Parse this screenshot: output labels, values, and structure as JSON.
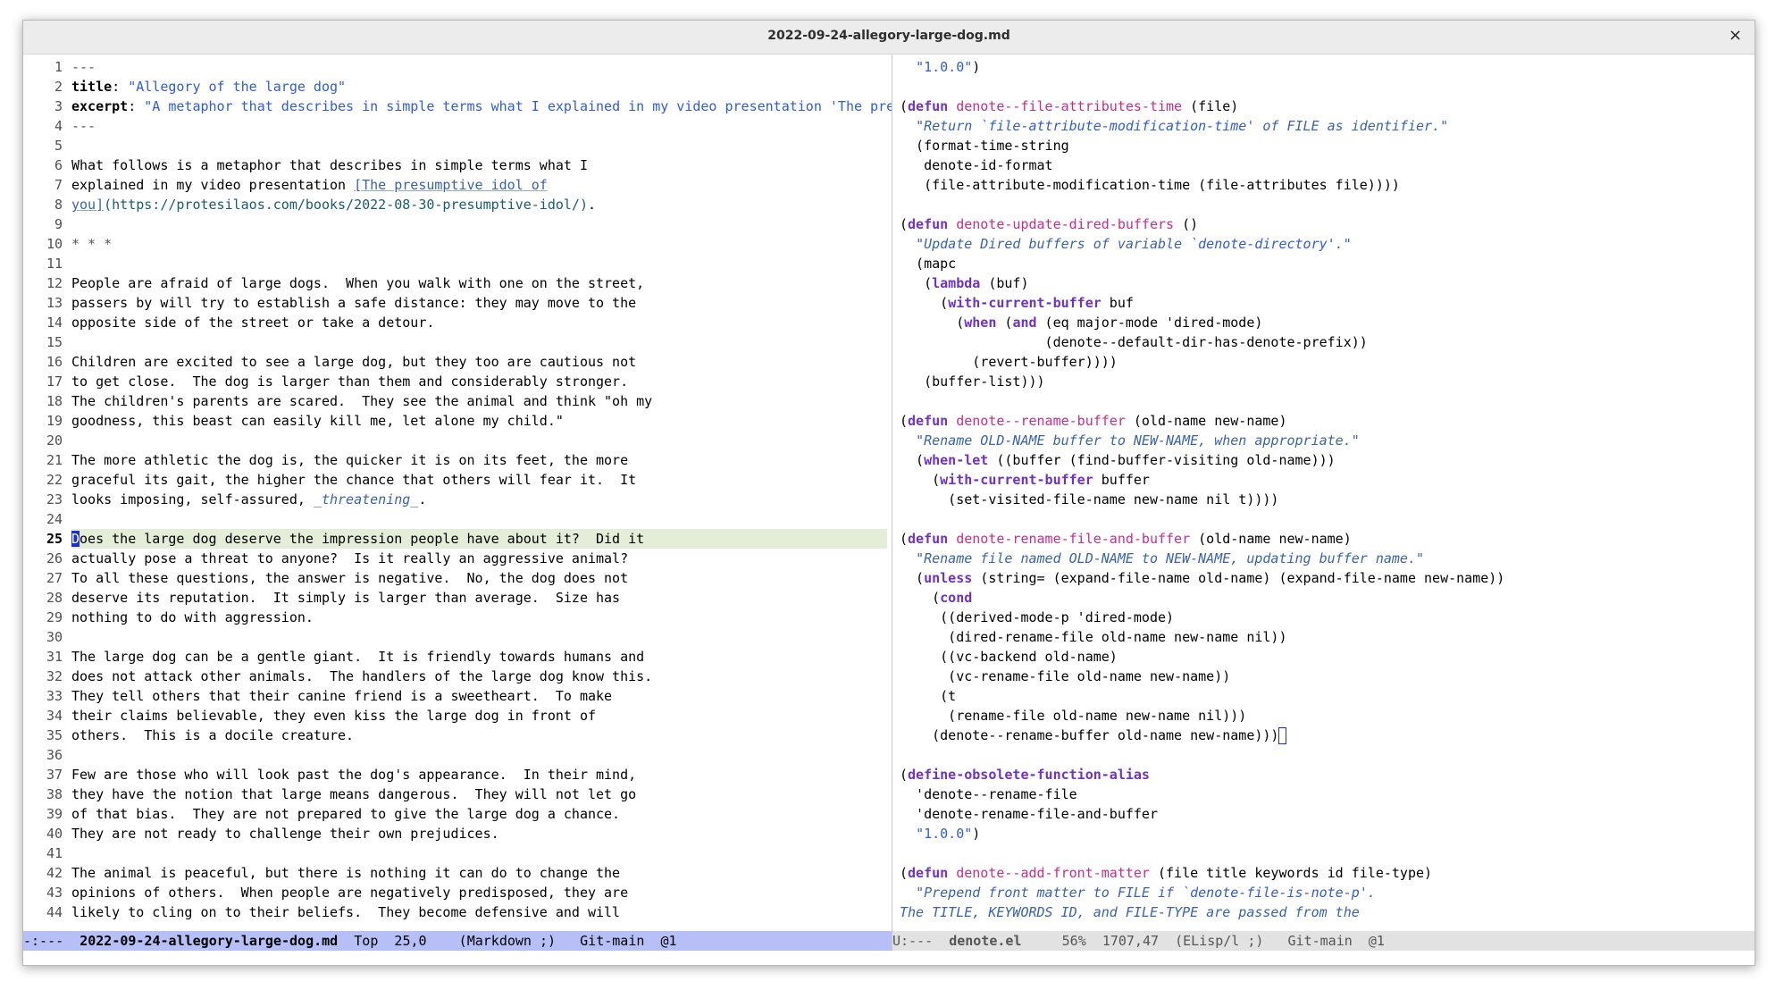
{
  "window": {
    "title": "2022-09-24-allegory-large-dog.md",
    "close_glyph": "×"
  },
  "left_pane": {
    "lines": [
      {
        "n": "1",
        "segs": [
          {
            "t": "---",
            "c": "mark"
          }
        ]
      },
      {
        "n": "2",
        "segs": [
          {
            "t": "title",
            "c": "hdr"
          },
          {
            "t": ": "
          },
          {
            "t": "\"Allegory of the large dog\"",
            "c": "str"
          }
        ]
      },
      {
        "n": "3",
        "segs": [
          {
            "t": "excerpt",
            "c": "hdr"
          },
          {
            "t": ": "
          },
          {
            "t": "\"A metaphor that describes in simple terms what I explained in my video presentation 'The presumpti",
            "c": "str"
          },
          {
            "t": "↩",
            "c": "mark"
          }
        ]
      },
      {
        "n": "4",
        "segs": [
          {
            "t": "---",
            "c": "mark"
          }
        ]
      },
      {
        "n": "5",
        "segs": []
      },
      {
        "n": "6",
        "segs": [
          {
            "t": "What follows is a metaphor that describes in simple terms what I"
          }
        ]
      },
      {
        "n": "7",
        "segs": [
          {
            "t": "explained in my video presentation "
          },
          {
            "t": "[The presumptive idol of",
            "c": "link"
          }
        ]
      },
      {
        "n": "8",
        "segs": [
          {
            "t": "you]",
            "c": "link"
          },
          {
            "t": "(https://protesilaos.com/books/2022-08-30-presumptive-idol/)",
            "c": "url"
          },
          {
            "t": "."
          }
        ]
      },
      {
        "n": "9",
        "segs": []
      },
      {
        "n": "10",
        "segs": [
          {
            "t": "* * *",
            "c": "mark"
          }
        ]
      },
      {
        "n": "11",
        "segs": []
      },
      {
        "n": "12",
        "segs": [
          {
            "t": "People are afraid of large dogs.  When you walk with one on the street,"
          }
        ]
      },
      {
        "n": "13",
        "segs": [
          {
            "t": "passers by will try to establish a safe distance: they may move to the"
          }
        ]
      },
      {
        "n": "14",
        "segs": [
          {
            "t": "opposite side of the street or take a detour."
          }
        ]
      },
      {
        "n": "15",
        "segs": []
      },
      {
        "n": "16",
        "segs": [
          {
            "t": "Children are excited to see a large dog, but they too are cautious not"
          }
        ]
      },
      {
        "n": "17",
        "segs": [
          {
            "t": "to get close.  The dog is larger than them and considerably stronger."
          }
        ]
      },
      {
        "n": "18",
        "segs": [
          {
            "t": "The children's parents are scared.  They see the animal and think \"oh my"
          }
        ]
      },
      {
        "n": "19",
        "segs": [
          {
            "t": "goodness, this beast can easily kill me, let alone my child.\""
          }
        ]
      },
      {
        "n": "20",
        "segs": []
      },
      {
        "n": "21",
        "segs": [
          {
            "t": "The more athletic the dog is, the quicker it is on its feet, the more"
          }
        ]
      },
      {
        "n": "22",
        "segs": [
          {
            "t": "graceful its gait, the higher the chance that others will fear it.  It"
          }
        ]
      },
      {
        "n": "23",
        "segs": [
          {
            "t": "looks imposing, self-assured, "
          },
          {
            "t": "_threatening_",
            "c": "doc"
          },
          {
            "t": "."
          }
        ]
      },
      {
        "n": "24",
        "segs": []
      },
      {
        "n": "25",
        "cur": true,
        "segs": [
          {
            "t": "D",
            "c": "cursor"
          },
          {
            "t": "oes the large dog deserve the impression people have about it?  Did it"
          }
        ]
      },
      {
        "n": "26",
        "segs": [
          {
            "t": "actually pose a threat to anyone?  Is it really an aggressive animal?"
          }
        ]
      },
      {
        "n": "27",
        "segs": [
          {
            "t": "To all these questions, the answer is negative.  No, the dog does not"
          }
        ]
      },
      {
        "n": "28",
        "segs": [
          {
            "t": "deserve its reputation.  It simply is larger than average.  Size has"
          }
        ]
      },
      {
        "n": "29",
        "segs": [
          {
            "t": "nothing to do with aggression."
          }
        ]
      },
      {
        "n": "30",
        "segs": []
      },
      {
        "n": "31",
        "segs": [
          {
            "t": "The large dog can be a gentle giant.  It is friendly towards humans and"
          }
        ]
      },
      {
        "n": "32",
        "segs": [
          {
            "t": "does not attack other animals.  The handlers of the large dog know this."
          }
        ]
      },
      {
        "n": "33",
        "segs": [
          {
            "t": "They tell others that their canine friend is a sweetheart.  To make"
          }
        ]
      },
      {
        "n": "34",
        "segs": [
          {
            "t": "their claims believable, they even kiss the large dog in front of"
          }
        ]
      },
      {
        "n": "35",
        "segs": [
          {
            "t": "others.  This is a docile creature."
          }
        ]
      },
      {
        "n": "36",
        "segs": []
      },
      {
        "n": "37",
        "segs": [
          {
            "t": "Few are those who will look past the dog's appearance.  In their mind,"
          }
        ]
      },
      {
        "n": "38",
        "segs": [
          {
            "t": "they have the notion that large means dangerous.  They will not let go"
          }
        ]
      },
      {
        "n": "39",
        "segs": [
          {
            "t": "of that bias.  They are not prepared to give the large dog a chance."
          }
        ]
      },
      {
        "n": "40",
        "segs": [
          {
            "t": "They are not ready to challenge their own prejudices."
          }
        ]
      },
      {
        "n": "41",
        "segs": []
      },
      {
        "n": "42",
        "segs": [
          {
            "t": "The animal is peaceful, but there is nothing it can do to change the"
          }
        ]
      },
      {
        "n": "43",
        "segs": [
          {
            "t": "opinions of others.  When people are negatively predisposed, they are"
          }
        ]
      },
      {
        "n": "44",
        "segs": [
          {
            "t": "likely to cling on to their beliefs.  They become defensive and will"
          }
        ]
      }
    ],
    "modeline": {
      "state": "-:---",
      "buffer": "2022-09-24-allegory-large-dog.md",
      "position": "Top",
      "linecol": "25,0",
      "mode": "(Markdown ;)",
      "vc": "Git-main",
      "tab": "@1"
    }
  },
  "right_pane": {
    "lines": [
      [
        {
          "t": "  "
        },
        {
          "t": "\"1.0.0\"",
          "c": "str"
        },
        {
          "t": ")"
        }
      ],
      [],
      [
        {
          "t": "("
        },
        {
          "t": "defun",
          "c": "kw"
        },
        {
          "t": " "
        },
        {
          "t": "denote--file-attributes-time",
          "c": "fn"
        },
        {
          "t": " (file)"
        }
      ],
      [
        {
          "t": "  "
        },
        {
          "t": "\"Return `",
          "c": "doc"
        },
        {
          "t": "file-attribute-modification-time",
          "c": "docsym"
        },
        {
          "t": "' of FILE as identifier.\"",
          "c": "doc"
        }
      ],
      [
        {
          "t": "  (format-time-string"
        }
      ],
      [
        {
          "t": "   denote-id-format"
        }
      ],
      [
        {
          "t": "   (file-attribute-modification-time (file-attributes file))))"
        }
      ],
      [],
      [
        {
          "t": "("
        },
        {
          "t": "defun",
          "c": "kw"
        },
        {
          "t": " "
        },
        {
          "t": "denote-update-dired-buffers",
          "c": "fn"
        },
        {
          "t": " ()"
        }
      ],
      [
        {
          "t": "  "
        },
        {
          "t": "\"Update Dired buffers of variable `",
          "c": "doc"
        },
        {
          "t": "denote-directory",
          "c": "docsym"
        },
        {
          "t": "'.\"",
          "c": "doc"
        }
      ],
      [
        {
          "t": "  (mapc"
        }
      ],
      [
        {
          "t": "   ("
        },
        {
          "t": "lambda",
          "c": "kw"
        },
        {
          "t": " (buf)"
        }
      ],
      [
        {
          "t": "     ("
        },
        {
          "t": "with-current-buffer",
          "c": "kw"
        },
        {
          "t": " buf"
        }
      ],
      [
        {
          "t": "       ("
        },
        {
          "t": "when",
          "c": "kw"
        },
        {
          "t": " ("
        },
        {
          "t": "and",
          "c": "kw"
        },
        {
          "t": " (eq major-mode 'dired-mode)"
        }
      ],
      [
        {
          "t": "                  (denote--default-dir-has-denote-prefix))"
        }
      ],
      [
        {
          "t": "         (revert-buffer))))"
        }
      ],
      [
        {
          "t": "   (buffer-list)))"
        }
      ],
      [],
      [
        {
          "t": "("
        },
        {
          "t": "defun",
          "c": "kw"
        },
        {
          "t": " "
        },
        {
          "t": "denote--rename-buffer",
          "c": "fn"
        },
        {
          "t": " (old-name new-name)"
        }
      ],
      [
        {
          "t": "  "
        },
        {
          "t": "\"Rename OLD-NAME buffer to NEW-NAME, when appropriate.\"",
          "c": "doc"
        }
      ],
      [
        {
          "t": "  ("
        },
        {
          "t": "when-let",
          "c": "kw"
        },
        {
          "t": " ((buffer (find-buffer-visiting old-name)))"
        }
      ],
      [
        {
          "t": "    ("
        },
        {
          "t": "with-current-buffer",
          "c": "kw"
        },
        {
          "t": " buffer"
        }
      ],
      [
        {
          "t": "      (set-visited-file-name new-name nil t))))"
        }
      ],
      [],
      [
        {
          "t": "("
        },
        {
          "t": "defun",
          "c": "kw"
        },
        {
          "t": " "
        },
        {
          "t": "denote-rename-file-and-buffer",
          "c": "fn"
        },
        {
          "t": " (old-name new-name)"
        }
      ],
      [
        {
          "t": "  "
        },
        {
          "t": "\"Rename file named OLD-NAME to NEW-NAME, updating buffer name.\"",
          "c": "doc"
        }
      ],
      [
        {
          "t": "  ("
        },
        {
          "t": "unless",
          "c": "kw"
        },
        {
          "t": " (string= (expand-file-name old-name) (expand-file-name new-name))"
        }
      ],
      [
        {
          "t": "    ("
        },
        {
          "t": "cond",
          "c": "kw"
        }
      ],
      [
        {
          "t": "     ((derived-mode-p 'dired-mode)"
        }
      ],
      [
        {
          "t": "      (dired-rename-file old-name new-name nil))"
        }
      ],
      [
        {
          "t": "     ((vc-backend old-name)"
        }
      ],
      [
        {
          "t": "      (vc-rename-file old-name new-name))"
        }
      ],
      [
        {
          "t": "     (t"
        }
      ],
      [
        {
          "t": "      (rename-file old-name new-name nil)))"
        }
      ],
      [
        {
          "t": "    (denote--rename-buffer old-name new-name)))"
        },
        {
          "t": "",
          "c": "boxcur"
        }
      ],
      [],
      [
        {
          "t": "("
        },
        {
          "t": "define-obsolete-function-alias",
          "c": "kw"
        }
      ],
      [
        {
          "t": "  'denote--rename-file"
        }
      ],
      [
        {
          "t": "  'denote-rename-file-and-buffer"
        }
      ],
      [
        {
          "t": "  "
        },
        {
          "t": "\"1.0.0\"",
          "c": "str"
        },
        {
          "t": ")"
        }
      ],
      [],
      [
        {
          "t": "("
        },
        {
          "t": "defun",
          "c": "kw"
        },
        {
          "t": " "
        },
        {
          "t": "denote--add-front-matter",
          "c": "fn"
        },
        {
          "t": " (file title keywords id file-type)"
        }
      ],
      [
        {
          "t": "  "
        },
        {
          "t": "\"Prepend front matter to FILE if `",
          "c": "doc"
        },
        {
          "t": "denote-file-is-note-p",
          "c": "docsym"
        },
        {
          "t": "'.",
          "c": "doc"
        }
      ],
      [
        {
          "t": "The TITLE, KEYWORDS ID, and FILE-TYPE are passed from the",
          "c": "doc"
        }
      ]
    ],
    "modeline": {
      "state": "U:---",
      "buffer": "denote.el",
      "position": "56%",
      "linecol": "1707,47",
      "mode": "(ELisp/l ;)",
      "vc": "Git-main",
      "tab": "@1"
    }
  }
}
